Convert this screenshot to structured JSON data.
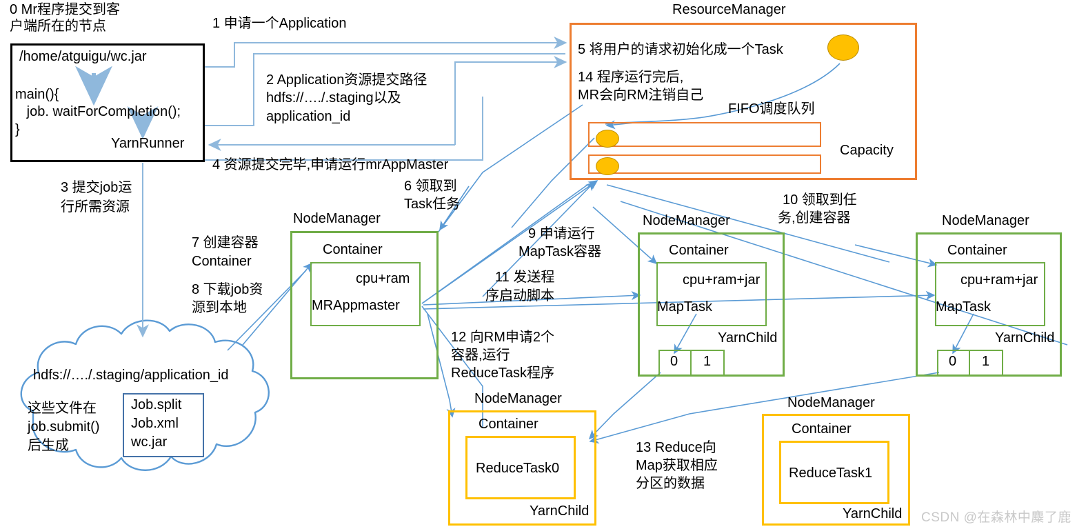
{
  "diagram": {
    "title": "Hadoop YARN MapReduce job submission workflow",
    "watermark": "CSDN @在森林中麋了鹿",
    "colors": {
      "arrow": "#5B9BD5",
      "resourcemanager_border": "#ED7D31",
      "nodemanager_green": "#70AD47",
      "nodemanager_yellow": "#FFC000",
      "client_border": "#000000",
      "cloud_border": "#5B9BD5",
      "task_fill": "#FFC000",
      "files_border": "#4472A8",
      "watermark_color": "#c9c9c9"
    }
  },
  "client": {
    "caption_line1": "0 Mr程序提交到客",
    "caption_line2": "户端所在的节点",
    "jar_path": "/home/atguigu/wc.jar",
    "code_line1": "main(){",
    "code_line2": "   job. waitForCompletion();",
    "code_line3": "}",
    "yarn_runner": "YarnRunner"
  },
  "resourcemanager": {
    "title": "ResourceManager",
    "step5": "5 将用户的请求初始化成一个Task",
    "step14_line1": "14 程序运行完后,",
    "step14_line2": "MR会向RM注销自己",
    "fifo_label": "FIFO调度队列",
    "capacity_label": "Capacity"
  },
  "hdfs": {
    "path": "hdfs://…./.staging/application_id",
    "note_line1": "这些文件在",
    "note_line2": "job.submit()",
    "note_line3": "后生成",
    "files": [
      "Job.split",
      "Job.xml",
      "wc.jar"
    ]
  },
  "nodemanagers": [
    {
      "id": "nm-appmaster",
      "title": "NodeManager",
      "container_label": "Container",
      "resource_label": "cpu+ram",
      "task_label": "MRAppmaster",
      "yarnchild_label": "",
      "partitions": []
    },
    {
      "id": "nm-maptask-1",
      "title": "NodeManager",
      "container_label": "Container",
      "resource_label": "cpu+ram+jar",
      "task_label": "MapTask",
      "yarnchild_label": "YarnChild",
      "partitions": [
        "0",
        "1"
      ]
    },
    {
      "id": "nm-maptask-2",
      "title": "NodeManager",
      "container_label": "Container",
      "resource_label": "cpu+ram+jar",
      "task_label": "MapTask",
      "yarnchild_label": "YarnChild",
      "partitions": [
        "0",
        "1"
      ]
    },
    {
      "id": "nm-reducetask-0",
      "title": "NodeManager",
      "container_label": "Container",
      "resource_label": "",
      "task_label": "ReduceTask0",
      "yarnchild_label": "YarnChild",
      "partitions": []
    },
    {
      "id": "nm-reducetask-1",
      "title": "NodeManager",
      "container_label": "Container",
      "resource_label": "",
      "task_label": "ReduceTask1",
      "yarnchild_label": "YarnChild",
      "partitions": []
    }
  ],
  "steps": {
    "s1": "1 申请一个Application",
    "s2_line1": "2 Application资源提交路径",
    "s2_line2": "hdfs://…./.staging以及",
    "s2_line3": "application_id",
    "s3_line1": "3 提交job运",
    "s3_line2": "行所需资源",
    "s4": "4 资源提交完毕,申请运行mrAppMaster",
    "s6_line1": "6 领取到",
    "s6_line2": "Task任务",
    "s7_line1": "7 创建容器",
    "s7_line2": "Container",
    "s8_line1": "8 下载job资",
    "s8_line2": "源到本地",
    "s9_line1": "9 申请运行",
    "s9_line2": "MapTask容器",
    "s10_line1": "10 领取到任",
    "s10_line2": "务,创建容器",
    "s11_line1": "11 发送程",
    "s11_line2": "序启动脚本",
    "s12_line1": "12 向RM申请2个",
    "s12_line2": "容器,运行",
    "s12_line3": "ReduceTask程序",
    "s13_line1": "13 Reduce向",
    "s13_line2": "Map获取相应",
    "s13_line3": "分区的数据"
  }
}
